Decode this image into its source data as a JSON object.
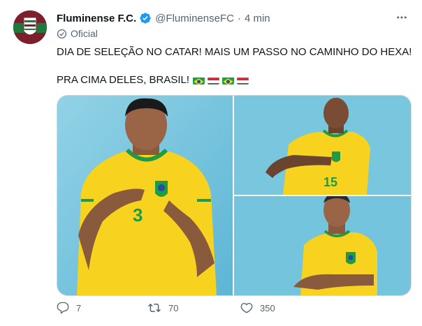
{
  "tweet": {
    "name": "Fluminense F.C.",
    "handle": "@FluminenseFC",
    "separator": "·",
    "time": "4 min",
    "affiliation": "Oficial",
    "line1": "DIA DE SELEÇÃO NO CATAR! MAIS UM PASSO NO CAMINHO DO HEXA!",
    "line2": "PRA CIMA DELES, BRASIL!",
    "flags": [
      "brazil-flag",
      "hungary-flag",
      "brazil-flag",
      "hungary-flag"
    ],
    "photos": [
      {
        "jersey_number": "3"
      },
      {
        "jersey_number": "15"
      },
      {
        "jersey_number": ""
      }
    ]
  },
  "actions": {
    "replies": "7",
    "retweets": "70",
    "likes": "350"
  },
  "colors": {
    "text": "#0f1419",
    "muted": "#536471",
    "verified_blue": "#1d9bf0",
    "photo_bg": "#6ec3de",
    "jersey_yellow": "#f7d21e",
    "jersey_green": "#1e9c45",
    "fluminense_maroon": "#7a1f2b"
  }
}
